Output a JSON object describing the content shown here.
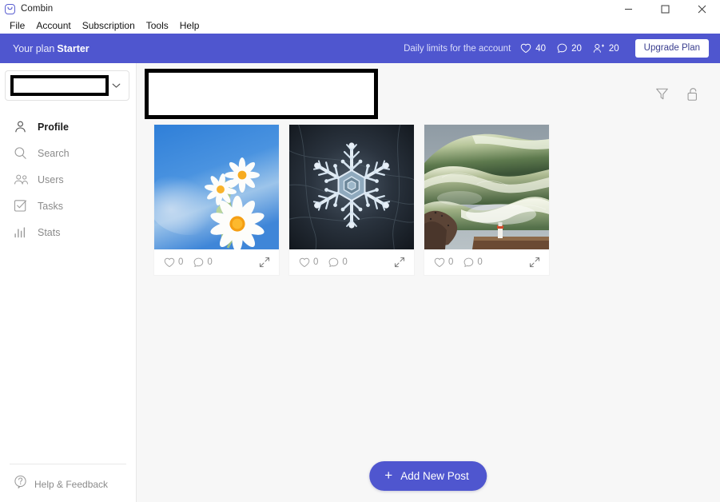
{
  "window": {
    "title": "Combin",
    "logo_icon": "combin-smile-logo",
    "controls": [
      {
        "name": "minimize",
        "icon": "minimize-icon"
      },
      {
        "name": "maximize",
        "icon": "maximize-icon"
      },
      {
        "name": "close",
        "icon": "close-icon"
      }
    ]
  },
  "menubar": {
    "items": [
      {
        "label": "File"
      },
      {
        "label": "Account"
      },
      {
        "label": "Subscription"
      },
      {
        "label": "Tools"
      },
      {
        "label": "Help"
      }
    ]
  },
  "planbar": {
    "plan_prefix": "Your plan",
    "plan_name": "Starter",
    "limits_label": "Daily limits for the account",
    "limits": [
      {
        "icon": "heart-icon",
        "value": "40"
      },
      {
        "icon": "comment-icon",
        "value": "20"
      },
      {
        "icon": "follow-user-icon",
        "value": "20"
      }
    ],
    "upgrade_label": "Upgrade Plan",
    "background_color": "#4f56cf",
    "accent_color": "#ffffff"
  },
  "sidebar": {
    "account_selector": {
      "value": "",
      "redacted": true,
      "chevron_icon": "chevron-down-icon"
    },
    "items": [
      {
        "label": "Profile",
        "icon": "person-icon",
        "active": true
      },
      {
        "label": "Search",
        "icon": "search-icon",
        "active": false
      },
      {
        "label": "Users",
        "icon": "users-icon",
        "active": false
      },
      {
        "label": "Tasks",
        "icon": "tasks-checkbox-icon",
        "active": false
      },
      {
        "label": "Stats",
        "icon": "stats-bars-icon",
        "active": false
      }
    ],
    "footer": {
      "help_label": "Help & Feedback",
      "help_icon": "question-circle-icon"
    }
  },
  "main": {
    "account_banner": {
      "value": "",
      "redacted": true
    },
    "actions": [
      {
        "name": "filter",
        "icon": "filter-funnel-icon"
      },
      {
        "name": "unlock",
        "icon": "unlock-padlock-icon"
      }
    ],
    "posts": [
      {
        "image_alt": "daisy-flowers-on-blue-sky",
        "likes": "0",
        "comments": "0",
        "like_icon": "heart-icon",
        "comment_icon": "comment-icon",
        "expand_icon": "expand-arrows-icon"
      },
      {
        "image_alt": "snowflake-macro-on-dark-background",
        "likes": "0",
        "comments": "0",
        "like_icon": "heart-icon",
        "comment_icon": "comment-icon",
        "expand_icon": "expand-arrows-icon"
      },
      {
        "image_alt": "giant-ocean-waves-with-lighthouse",
        "likes": "0",
        "comments": "0",
        "like_icon": "heart-icon",
        "comment_icon": "comment-icon",
        "expand_icon": "expand-arrows-icon"
      }
    ],
    "add_post": {
      "label": "Add New Post",
      "plus_icon": "plus-icon"
    },
    "background_color": "#f7f7f7"
  }
}
